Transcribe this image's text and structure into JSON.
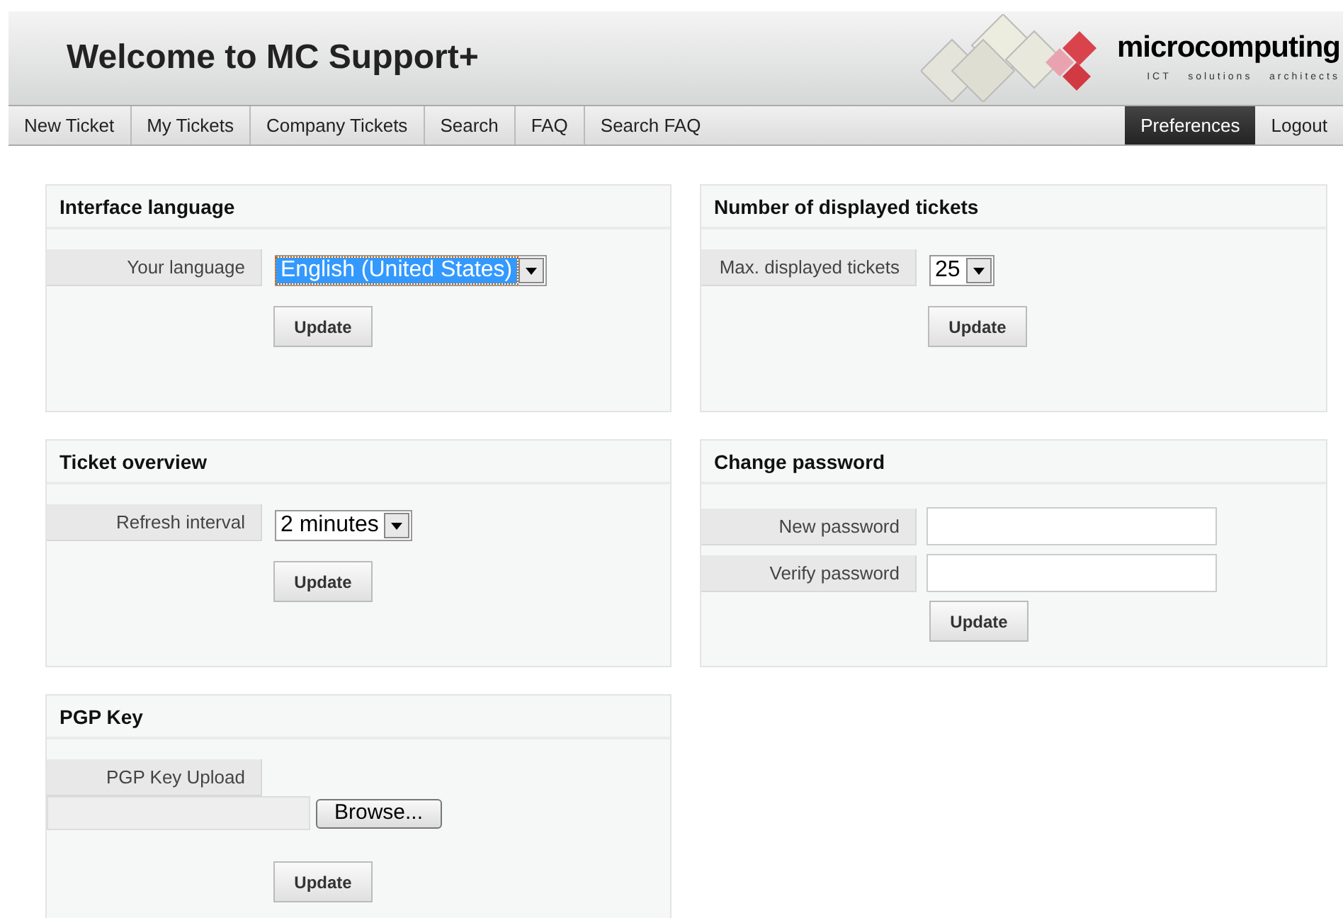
{
  "header": {
    "title": "Welcome to MC Support+",
    "logo": {
      "name": "microcomputing",
      "tagline": "ICT   solutions   architects"
    }
  },
  "nav": {
    "left": [
      {
        "label": "New Ticket",
        "selected": false
      },
      {
        "label": "My Tickets",
        "selected": false
      },
      {
        "label": "Company Tickets",
        "selected": false
      },
      {
        "label": "Search",
        "selected": false
      },
      {
        "label": "FAQ",
        "selected": false
      },
      {
        "label": "Search FAQ",
        "selected": false
      }
    ],
    "right": [
      {
        "label": "Preferences",
        "selected": true
      },
      {
        "label": "Logout",
        "selected": false
      }
    ]
  },
  "panels": [
    {
      "title": "Interface language",
      "rows": [
        {
          "kind": "select",
          "label": "Your language",
          "value": "English (United States)",
          "highlighted": true
        }
      ],
      "button": "Update"
    },
    {
      "title": "Number of displayed tickets",
      "rows": [
        {
          "kind": "select",
          "label": "Max. displayed tickets",
          "value": "25",
          "highlighted": false
        }
      ],
      "button": "Update"
    },
    {
      "title": "Ticket overview",
      "rows": [
        {
          "kind": "select",
          "label": "Refresh interval",
          "value": "2 minutes",
          "highlighted": false
        }
      ],
      "button": "Update"
    },
    {
      "title": "Change password",
      "rows": [
        {
          "kind": "password",
          "label": "New password"
        },
        {
          "kind": "password",
          "label": "Verify password"
        }
      ],
      "button": "Update"
    },
    {
      "title": "PGP Key",
      "rows": [
        {
          "kind": "file",
          "label": "PGP Key Upload",
          "browse": "Browse..."
        }
      ],
      "button": "Update"
    }
  ]
}
